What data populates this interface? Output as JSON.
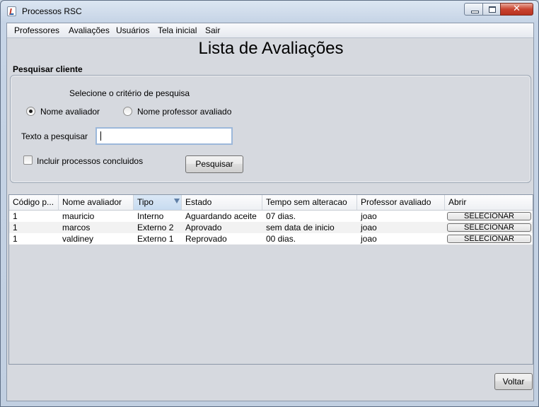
{
  "window": {
    "title": "Processos RSC",
    "close_glyph": "✕"
  },
  "menubar": [
    "Professores",
    "Avaliações",
    "Usuários",
    "Tela inicial",
    "Sair"
  ],
  "page_title": "Lista de Avaliações",
  "search": {
    "group_title": "Pesquisar cliente",
    "criteria_label": "Selecione o critério de pesquisa",
    "radio_options": [
      {
        "label": "Nome avaliador",
        "selected": true
      },
      {
        "label": "Nome professor avaliado",
        "selected": false
      }
    ],
    "text_label": "Texto a pesquisar",
    "text_value": "",
    "include_label": "Incluir processos concluidos",
    "include_checked": false,
    "search_button": "Pesquisar"
  },
  "table": {
    "columns": [
      "Código p...",
      "Nome avaliador",
      "Tipo",
      "Estado",
      "Tempo sem alteracao",
      "Professor avaliado",
      "Abrir"
    ],
    "sorted_column": "Tipo",
    "rows": [
      [
        "1",
        "mauricio",
        "Interno",
        "Aguardando aceite",
        "07 dias.",
        "joao",
        "SELECIONAR"
      ],
      [
        "1",
        "marcos",
        "Externo 2",
        "Aprovado",
        "sem data de inicio",
        "joao",
        "SELECIONAR"
      ],
      [
        "1",
        "valdiney",
        "Externo 1",
        "Reprovado",
        "00 dias.",
        "joao",
        "SELECIONAR"
      ]
    ]
  },
  "footer": {
    "back_button": "Voltar"
  },
  "colors": {
    "accent_header": "#c7dbf0",
    "window_frame": "#c1cfe1",
    "panel_bg": "#d6d9df"
  }
}
